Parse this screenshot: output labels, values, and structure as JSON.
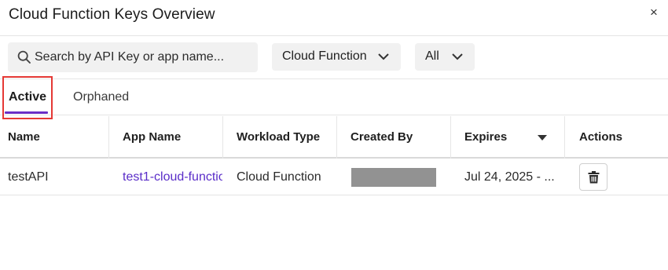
{
  "dialog": {
    "title": "Cloud Function Keys Overview",
    "close_symbol": "×"
  },
  "filters": {
    "search_placeholder": "Search by API Key or app name...",
    "workload_select": "Cloud Function",
    "status_select": "All"
  },
  "tabs": [
    {
      "label": "Active",
      "selected": true
    },
    {
      "label": "Orphaned",
      "selected": false
    }
  ],
  "table": {
    "columns": [
      "Name",
      "App Name",
      "Workload Type",
      "Created By",
      "Expires",
      "Actions"
    ],
    "sorted_column": "Expires",
    "rows": [
      {
        "name": "testAPI",
        "app_name": "test1-cloud-functio",
        "workload_type": "Cloud Function",
        "created_by": "",
        "expires": "Jul 24, 2025 - ..."
      }
    ]
  },
  "colors": {
    "accent": "#6a2fc6",
    "link": "#5a2dc8",
    "highlight": "#e53935"
  }
}
